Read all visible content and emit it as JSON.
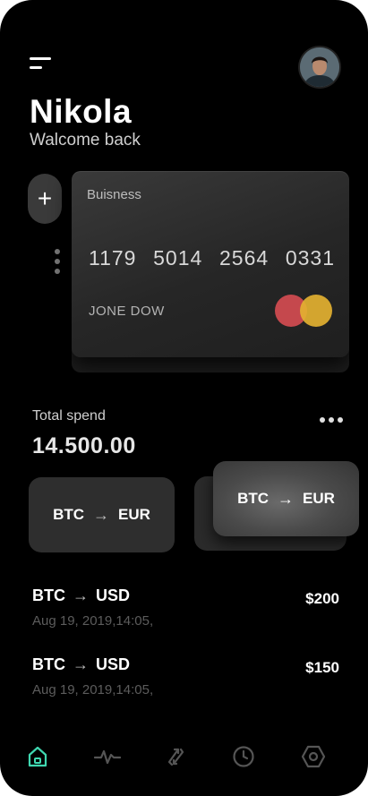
{
  "header": {
    "name": "Nikola",
    "subtitle": "Walcome back"
  },
  "card": {
    "type": "Buisness",
    "number_groups": [
      "1179",
      "5014",
      "2564",
      "0331"
    ],
    "holder": "JONE DOW",
    "brand_icon": "mastercard-icon"
  },
  "spend": {
    "label": "Total spend",
    "value": "14.500.00"
  },
  "pairs": [
    {
      "from": "BTC",
      "to": "EUR"
    },
    {
      "from": "BTC",
      "to": "EUR"
    }
  ],
  "transactions": [
    {
      "from": "BTC",
      "to": "USD",
      "date": "Aug 19, 2019,14:05,",
      "amount": "$200"
    },
    {
      "from": "BTC",
      "to": "USD",
      "date": "Aug 19, 2019,14:05,",
      "amount": "$150"
    }
  ],
  "add_label": "+",
  "arrow": "→",
  "tabs": [
    {
      "icon": "home-icon",
      "active": true
    },
    {
      "icon": "activity-icon",
      "active": false
    },
    {
      "icon": "transfer-icon",
      "active": false
    },
    {
      "icon": "clock-icon",
      "active": false
    },
    {
      "icon": "settings-hexagon-icon",
      "active": false
    }
  ],
  "colors": {
    "background": "#000000",
    "accent": "#3fd7b0",
    "card": "#2a2a2a",
    "mastercard_red": "#c5484d",
    "mastercard_yellow": "#e3b131"
  }
}
